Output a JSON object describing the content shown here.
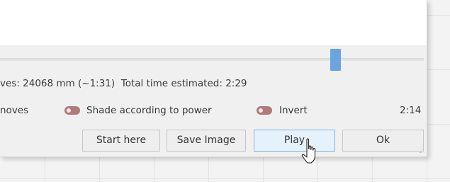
{
  "info": {
    "moves_text": "ves: 24068 mm (~1:31)",
    "total_text": "Total time estimated: 2:29"
  },
  "options": {
    "moves_label": "noves",
    "shade_label": "Shade according to power",
    "invert_label": "Invert",
    "time_label": "2:14"
  },
  "buttons": {
    "start_here": "Start here",
    "save_image": "Save Image",
    "play": "Play",
    "ok": "Ok"
  },
  "colors": {
    "slider_thumb": "#6aa5e2",
    "toggle": "#b07a7a",
    "hover_button": "#e5f1fb"
  },
  "icons": {
    "cursor": "hand-pointer-icon"
  }
}
